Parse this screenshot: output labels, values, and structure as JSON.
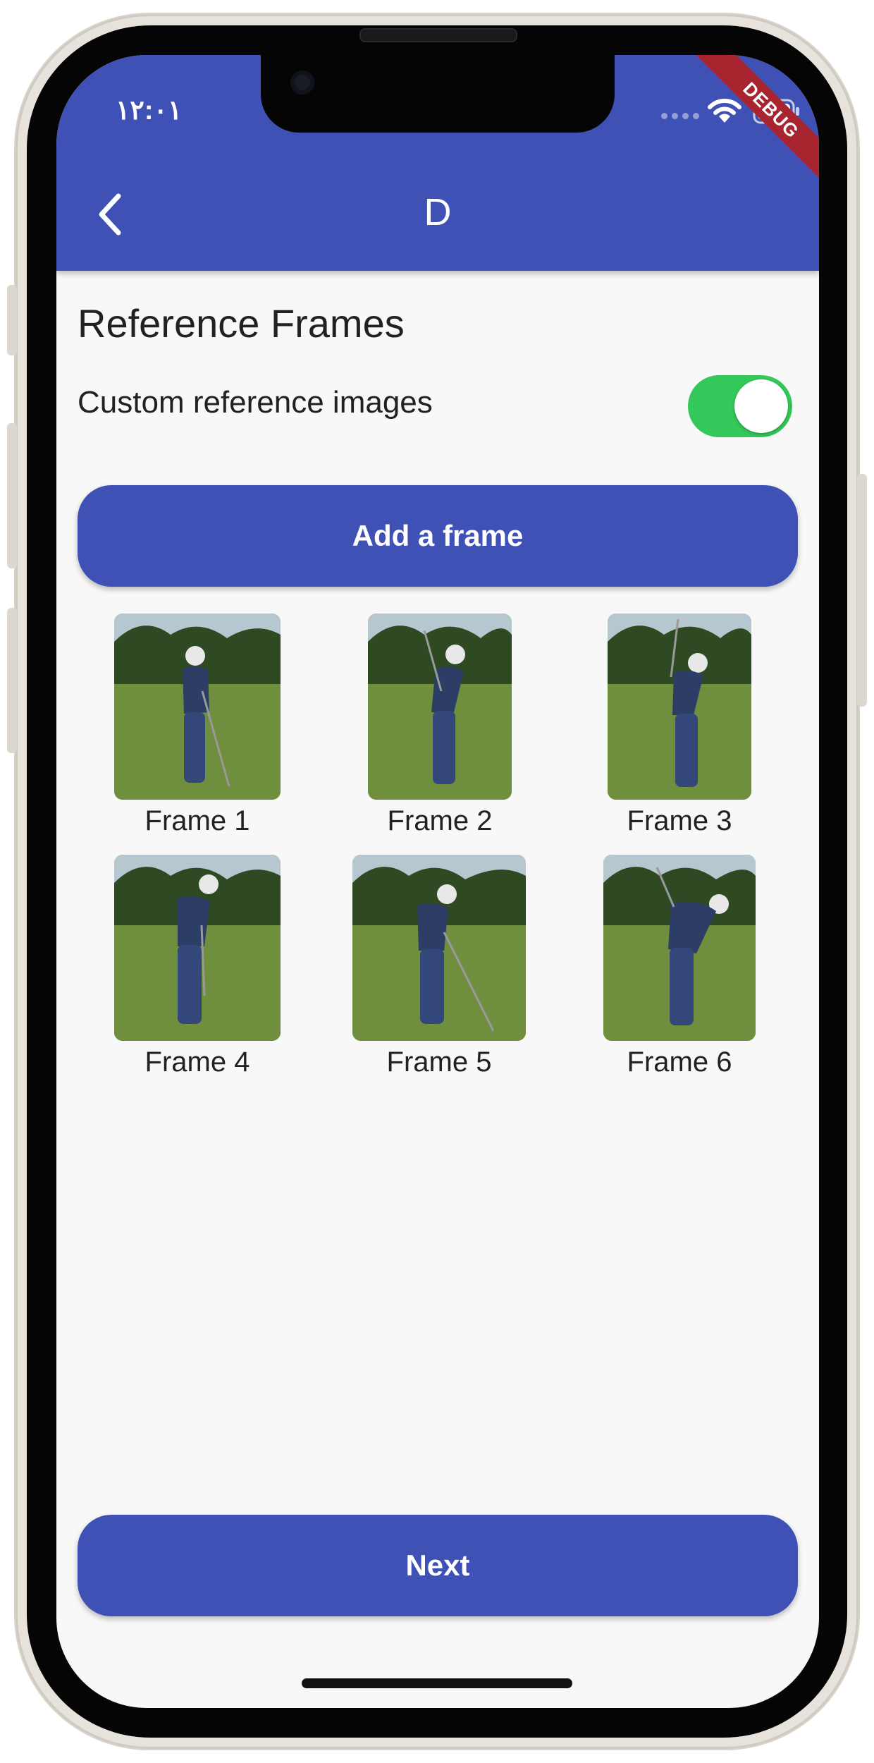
{
  "status_bar": {
    "time": "١٢:٠١",
    "debug_banner": "DEBUG"
  },
  "app_bar": {
    "title": "D",
    "back_icon": "chevron-left-icon"
  },
  "reference": {
    "title": "Reference Frames",
    "toggle_label": "Custom reference images",
    "toggle_on": true,
    "add_button": "Add a frame"
  },
  "frames": [
    {
      "label": "Frame 1"
    },
    {
      "label": "Frame 2"
    },
    {
      "label": "Frame 3"
    },
    {
      "label": "Frame 4"
    },
    {
      "label": "Frame 5"
    },
    {
      "label": "Frame 6"
    }
  ],
  "footer": {
    "next_button": "Next"
  },
  "colors": {
    "primary": "#3f51b5",
    "toggle_on": "#34c759",
    "debug": "#a8252f",
    "background": "#f8f8f8"
  }
}
